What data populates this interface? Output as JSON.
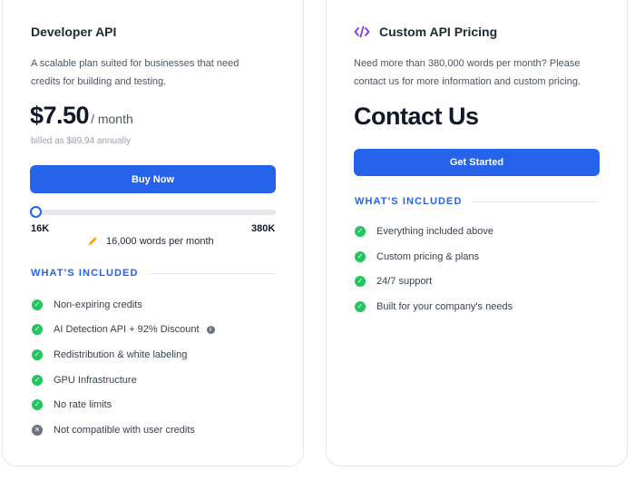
{
  "developer": {
    "title": "Developer API",
    "description_line1": "A scalable plan suited for businesses that need",
    "description_line2": "credits for building and testing.",
    "price": "$7.50",
    "price_unit": "/ month",
    "billing": "billed as $89.94 annually",
    "button_label": "Buy Now",
    "slider": {
      "min_label": "16K",
      "max_label": "380K",
      "value_fraction": 0.0,
      "value_label": "16,000 words per month",
      "value_icon": "pencil-icon"
    },
    "section_heading": "WHAT'S INCLUDED",
    "features": [
      {
        "label": "Non-expiring credits",
        "icon": "check-circle-icon"
      },
      {
        "label": "AI Detection API + 92% Discount",
        "icon": "check-circle-icon",
        "info": "info-icon"
      },
      {
        "label": "Redistribution & white labeling",
        "icon": "check-circle-icon"
      },
      {
        "label": "GPU Infrastructure",
        "icon": "check-circle-icon"
      },
      {
        "label": "No rate limits",
        "icon": "check-circle-icon"
      },
      {
        "label": "Not compatible with user credits",
        "icon": "x-circle-icon"
      }
    ]
  },
  "custom": {
    "icon": "code-icon",
    "title": "Custom API Pricing",
    "description_line1": "Need more than 380,000 words per month? Please",
    "description_line2": "contact us for more information and custom pricing.",
    "price": "Contact Us",
    "button_label": "Get Started",
    "section_heading": "WHAT'S INCLUDED",
    "features": [
      {
        "label": "Everything included above",
        "icon": "check-circle-icon"
      },
      {
        "label": "Custom pricing & plans",
        "icon": "check-circle-icon"
      },
      {
        "label": "24/7 support",
        "icon": "check-circle-icon"
      },
      {
        "label": "Built for your company's needs",
        "icon": "check-circle-icon"
      }
    ]
  },
  "colors": {
    "accent": "#2563eb",
    "check": "#22c55e",
    "muted_icon": "#6b7280",
    "code_icon": "#7c3aed",
    "pencil": "#f59e0b"
  }
}
